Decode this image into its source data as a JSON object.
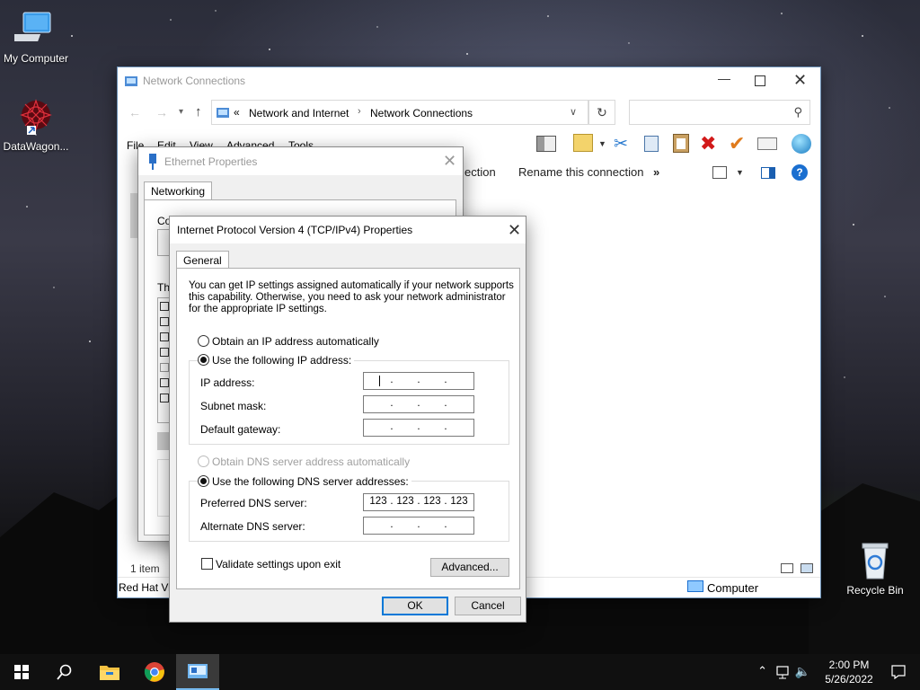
{
  "desktop": {
    "icons": [
      {
        "label": "My Computer",
        "icon": "computer-icon"
      },
      {
        "label": "DataWagon...",
        "icon": "datawagon-icon"
      },
      {
        "label": "Recycle Bin",
        "icon": "recycle-bin-icon"
      }
    ]
  },
  "taskbar": {
    "items": [
      "start-icon",
      "search-icon",
      "file-explorer-icon",
      "chrome-icon",
      "network-connections-icon"
    ],
    "time": "2:00 PM",
    "date": "5/26/2022"
  },
  "explorer": {
    "title": "Network Connections",
    "breadcrumb": [
      "Network and Internet",
      "Network Connections"
    ],
    "breadcrumb_prefix": "«",
    "menu": [
      "File",
      "Edit",
      "View",
      "Advanced",
      "Tools"
    ],
    "command_partial": "ection",
    "command_rename": "Rename this connection",
    "command_more": "»",
    "status_items": "1 item",
    "status_left": "Red Hat Vi",
    "status_computer": "Computer"
  },
  "ethernet": {
    "title": "Ethernet Properties",
    "tab": "Networking",
    "connect_using": "Connect using:",
    "this_conn": "Th"
  },
  "ipv4": {
    "title": "Internet Protocol Version 4 (TCP/IPv4) Properties",
    "tab": "General",
    "description": [
      "You can get IP settings assigned automatically if your network supports",
      "this capability. Otherwise, you need to ask your network administrator",
      "for the appropriate IP settings."
    ],
    "obtain_ip_auto": "Obtain an IP address automatically",
    "use_following_ip": "Use the following IP address:",
    "ip_address_label": "IP address:",
    "subnet_label": "Subnet mask:",
    "gateway_label": "Default gateway:",
    "obtain_dns_auto": "Obtain DNS server address automatically",
    "use_following_dns": "Use the following DNS server addresses:",
    "preferred_dns_label": "Preferred DNS server:",
    "alternate_dns_label": "Alternate DNS server:",
    "ip_address": [
      "",
      "",
      "",
      ""
    ],
    "subnet_mask": [
      "",
      "",
      "",
      ""
    ],
    "gateway": [
      "",
      "",
      "",
      ""
    ],
    "preferred_dns": [
      "123",
      "123",
      "123",
      "123"
    ],
    "alternate_dns": [
      "",
      "",
      "",
      ""
    ],
    "validate_label": "Validate settings upon exit",
    "advanced_label": "Advanced...",
    "ok_label": "OK",
    "cancel_label": "Cancel"
  }
}
